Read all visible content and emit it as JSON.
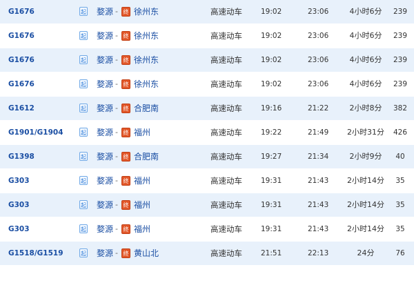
{
  "table": {
    "rows": [
      {
        "train": "G1676",
        "from_badge": "起",
        "from": "婺源",
        "dash": "-",
        "to_badge": "终",
        "to": "徐州东",
        "type": "高速动车",
        "dep": "19:02",
        "arr": "23:06",
        "duration": "4小时6分",
        "distance": "239"
      },
      {
        "train": "G1676",
        "from_badge": "起",
        "from": "婺源",
        "dash": "-",
        "to_badge": "终",
        "to": "徐州东",
        "type": "高速动车",
        "dep": "19:02",
        "arr": "23:06",
        "duration": "4小时6分",
        "distance": "239"
      },
      {
        "train": "G1676",
        "from_badge": "起",
        "from": "婺源",
        "dash": "-",
        "to_badge": "终",
        "to": "徐州东",
        "type": "高速动车",
        "dep": "19:02",
        "arr": "23:06",
        "duration": "4小时6分",
        "distance": "239"
      },
      {
        "train": "G1676",
        "from_badge": "起",
        "from": "婺源",
        "dash": "-",
        "to_badge": "终",
        "to": "徐州东",
        "type": "高速动车",
        "dep": "19:02",
        "arr": "23:06",
        "duration": "4小时6分",
        "distance": "239"
      },
      {
        "train": "G1612",
        "from_badge": "起",
        "from": "婺源",
        "dash": "-",
        "to_badge": "终",
        "to": "合肥南",
        "type": "高速动车",
        "dep": "19:16",
        "arr": "21:22",
        "duration": "2小时8分",
        "distance": "382"
      },
      {
        "train": "G1901/G1904",
        "from_badge": "起",
        "from": "婺源",
        "dash": "-",
        "to_badge": "终",
        "to": "福州",
        "type": "高速动车",
        "dep": "19:22",
        "arr": "21:49",
        "duration": "2小时31分",
        "distance": "426"
      },
      {
        "train": "G1398",
        "from_badge": "起",
        "from": "婺源",
        "dash": "-",
        "to_badge": "终",
        "to": "合肥南",
        "type": "高速动车",
        "dep": "19:27",
        "arr": "21:34",
        "duration": "2小时9分",
        "distance": "40"
      },
      {
        "train": "G303",
        "from_badge": "起",
        "from": "婺源",
        "dash": "-",
        "to_badge": "终",
        "to": "福州",
        "type": "高速动车",
        "dep": "19:31",
        "arr": "21:43",
        "duration": "2小时14分",
        "distance": "35"
      },
      {
        "train": "G303",
        "from_badge": "起",
        "from": "婺源",
        "dash": "-",
        "to_badge": "终",
        "to": "福州",
        "type": "高速动车",
        "dep": "19:31",
        "arr": "21:43",
        "duration": "2小时14分",
        "distance": "35"
      },
      {
        "train": "G303",
        "from_badge": "起",
        "from": "婺源",
        "dash": "-",
        "to_badge": "终",
        "to": "福州",
        "type": "高速动车",
        "dep": "19:31",
        "arr": "21:43",
        "duration": "2小时14分",
        "distance": "35"
      },
      {
        "train": "G1518/G1519",
        "from_badge": "起",
        "from": "婺源",
        "dash": "-",
        "to_badge": "终",
        "to": "黄山北",
        "type": "高速动车",
        "dep": "21:51",
        "arr": "22:13",
        "duration": "24分",
        "distance": "76"
      }
    ]
  },
  "colors": {
    "row_alt_bg": "#e8f1fb",
    "link_blue": "#1a4ea3",
    "start_badge_blue": "#2d7bd8",
    "end_badge_orange": "#e2582a"
  }
}
